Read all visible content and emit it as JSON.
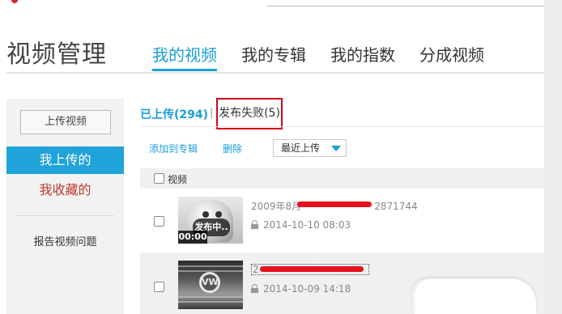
{
  "header": {
    "page_title": "视频管理",
    "tabs": [
      {
        "label": "我的视频",
        "active": true
      },
      {
        "label": "我的专辑",
        "active": false
      },
      {
        "label": "我的指数",
        "active": false
      },
      {
        "label": "分成视频",
        "active": false
      }
    ]
  },
  "sidebar": {
    "upload_button": "上传视频",
    "items": [
      {
        "label": "我上传的",
        "active": true
      },
      {
        "label": "我收藏的",
        "active": false
      }
    ],
    "report_link": "报告视频问题"
  },
  "subtabs": {
    "uploaded": "已上传(294)",
    "separator": "|",
    "failed": "发布失败(5)"
  },
  "actions": {
    "add_to_album": "添加到专辑",
    "delete": "删除",
    "sort_selected": "最近上传"
  },
  "list": {
    "header_label": "视频",
    "rows": [
      {
        "title_prefix": "2009年8月",
        "title_suffix": "2871744",
        "status_badge": "发布中..",
        "duration": "00:00",
        "timestamp": "2014-10-10 08:03"
      },
      {
        "title_prefix": "2",
        "title_suffix": "",
        "timestamp": "2014-10-09 14:18",
        "logo_text": "VW"
      }
    ]
  },
  "colors": {
    "accent": "#1a9fd9",
    "sidebar_active": "#1fa3d8",
    "favorite_text": "#c0392b",
    "highlight_box": "#d0021b"
  }
}
